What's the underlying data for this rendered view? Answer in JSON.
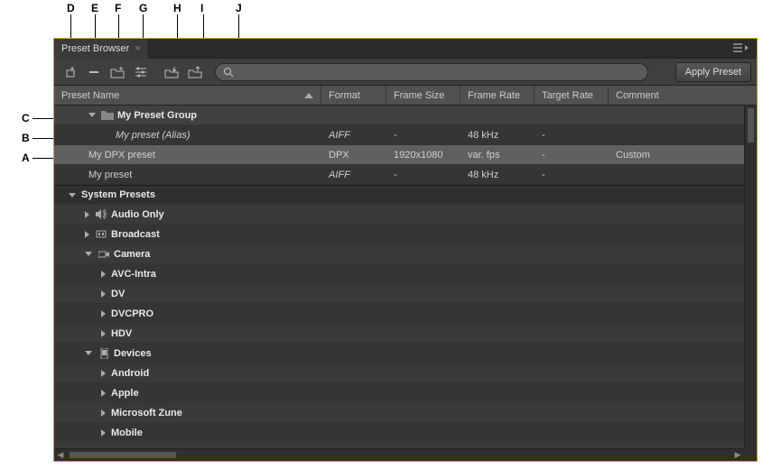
{
  "callouts": {
    "A": "A",
    "B": "B",
    "C": "C",
    "D": "D",
    "E": "E",
    "F": "F",
    "G": "G",
    "H": "H",
    "I": "I",
    "J": "J"
  },
  "tab": {
    "title": "Preset Browser"
  },
  "toolbar": {
    "apply_label": "Apply Preset",
    "search_placeholder": ""
  },
  "columns": {
    "name": "Preset Name",
    "format": "Format",
    "frameSize": "Frame Size",
    "frameRate": "Frame Rate",
    "targetRate": "Target Rate",
    "comment": "Comment"
  },
  "rows": {
    "myPresetGroup": "My Preset Group",
    "myPresetAlias": "My preset (Alias)",
    "myDpxPreset": "My DPX preset",
    "myPreset": "My preset",
    "systemPresets": "System Presets",
    "audioOnly": "Audio Only",
    "broadcast": "Broadcast",
    "camera": "Camera",
    "avcIntra": "AVC-Intra",
    "dv": "DV",
    "dvcpro": "DVCPRO",
    "hdv": "HDV",
    "devices": "Devices",
    "android": "Android",
    "apple": "Apple",
    "microsoftZune": "Microsoft Zune",
    "mobile": "Mobile"
  },
  "values": {
    "aiff": "AIFF",
    "dpx": "DPX",
    "dash": "-",
    "res1080": "1920x1080",
    "khz48": "48 kHz",
    "varfps": "var. fps",
    "custom": "Custom"
  }
}
